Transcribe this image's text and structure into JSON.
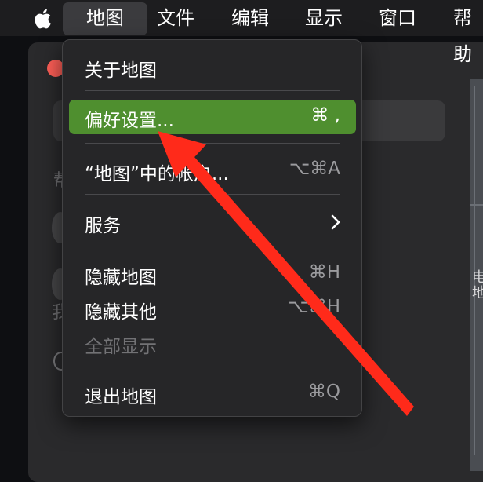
{
  "menubar": {
    "apple": "apple-icon",
    "items": [
      {
        "label": "地图"
      },
      {
        "label": "文件"
      },
      {
        "label": "编辑"
      },
      {
        "label": "显示"
      },
      {
        "label": "窗口"
      },
      {
        "label": "帮助"
      }
    ]
  },
  "dropdown": {
    "about": "关于地图",
    "preferences": {
      "label": "偏好设置...",
      "shortcut": "⌘ ,"
    },
    "accounts": {
      "label": "“地图”中的帐户...",
      "shortcut": "⌥⌘A"
    },
    "services": {
      "label": "服务",
      "icon": "chevron-right-icon"
    },
    "hide": {
      "label": "隐藏地图",
      "shortcut": "⌘H"
    },
    "hide_others": {
      "label": "隐藏其他",
      "shortcut": "⌥⌘H"
    },
    "show_all": {
      "label": "全部显示"
    },
    "quit": {
      "label": "退出地图",
      "shortcut": "⌘Q"
    }
  },
  "background": {
    "side_text_1": "帮",
    "side_text_2": "我",
    "map_label": "电\n地"
  },
  "colors": {
    "highlight": "#4f8f2f",
    "annotation_arrow": "#ff2a1a"
  }
}
